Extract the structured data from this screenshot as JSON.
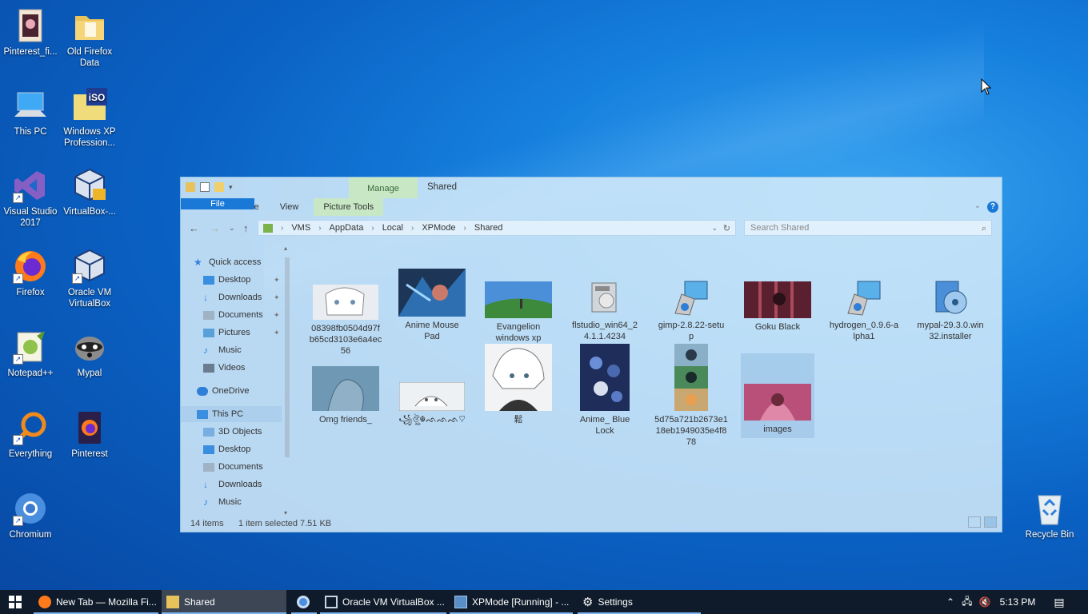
{
  "desktop": {
    "icons": [
      {
        "label": "Pinterest_fi...",
        "icon": "image-file-icon"
      },
      {
        "label": "Old Firefox Data",
        "icon": "folder-icon"
      },
      {
        "label": "This PC",
        "icon": "computer-icon"
      },
      {
        "label": "Windows XP Profession...",
        "icon": "iso-file-icon"
      },
      {
        "label": "Visual Studio 2017",
        "icon": "visual-studio-icon"
      },
      {
        "label": "VirtualBox-...",
        "icon": "virtualbox-installer-icon"
      },
      {
        "label": "Firefox",
        "icon": "firefox-icon"
      },
      {
        "label": "Oracle VM VirtualBox",
        "icon": "virtualbox-icon"
      },
      {
        "label": "Notepad++",
        "icon": "notepadpp-icon"
      },
      {
        "label": "Mypal",
        "icon": "mypal-icon"
      },
      {
        "label": "Everything",
        "icon": "everything-icon"
      },
      {
        "label": "Pinterest",
        "icon": "pinterest-app-icon"
      },
      {
        "label": "Chromium",
        "icon": "chromium-icon"
      },
      {
        "label": "Recycle Bin",
        "icon": "recycle-bin-icon"
      }
    ]
  },
  "explorer": {
    "title": "Shared",
    "contextual_tab_group": "Manage",
    "tabs": [
      "File",
      "Home",
      "Share",
      "View",
      "Picture Tools"
    ],
    "breadcrumb": [
      "VMS",
      "AppData",
      "Local",
      "XPMode",
      "Shared"
    ],
    "search_placeholder": "Search Shared",
    "nav": {
      "quick_access": "Quick access",
      "quick_items": [
        "Desktop",
        "Downloads",
        "Documents",
        "Pictures",
        "Music",
        "Videos"
      ],
      "onedrive": "OneDrive",
      "this_pc": "This PC",
      "pc_items": [
        "3D Objects",
        "Desktop",
        "Documents",
        "Downloads",
        "Music"
      ]
    },
    "files": [
      {
        "name": "08398fb0504d97fb65cd3103e6a4ec56",
        "lines": [
          "08398fb0504d97f",
          "b65cd3103e6a4ec",
          "56"
        ],
        "kind": "manga-image"
      },
      {
        "name": "Anime Mouse Pad",
        "lines": [
          "Anime Mouse",
          "Pad"
        ],
        "kind": "anime-image"
      },
      {
        "name": "Evangelion windows xp version",
        "lines": [
          "Evangelion",
          "windows xp",
          "version"
        ],
        "kind": "landscape-image"
      },
      {
        "name": "flstudio_win64_24.1.1.4234",
        "lines": [
          "flstudio_win64_2",
          "4.1.1.4234"
        ],
        "kind": "installer"
      },
      {
        "name": "gimp-2.8.22-setup",
        "lines": [
          "gimp-2.8.22-setu",
          "p"
        ],
        "kind": "setup"
      },
      {
        "name": "Goku Black",
        "lines": [
          "Goku Black"
        ],
        "kind": "dark-image"
      },
      {
        "name": "hydrogen_0.9.6-alpha1",
        "lines": [
          "hydrogen_0.9.6-a",
          "lpha1"
        ],
        "kind": "setup"
      },
      {
        "name": "mypal-29.3.0.win32.installer",
        "lines": [
          "mypal-29.3.0.win",
          "32.installer"
        ],
        "kind": "disc-installer"
      },
      {
        "name": "Omg friends_",
        "lines": [
          "Omg friends_"
        ],
        "kind": "sketch-image"
      },
      {
        "name": "꧁ঔৣ☬✞𝓚𝓲𝓵𝓵𝓾𝓪✞☬ঔৣ꧂",
        "lines": [
          "꧁ঔৣ☬ᨒᨒᨒ♡"
        ],
        "kind": "manga-image"
      },
      {
        "name": "鬆",
        "lines": [
          "鬆"
        ],
        "kind": "portrait-image"
      },
      {
        "name": "Anime_ Blue Lock",
        "lines": [
          "Anime_ Blue",
          "Lock"
        ],
        "kind": "poster-image"
      },
      {
        "name": "5d75a721b2673e118eb1949035e4f878",
        "lines": [
          "5d75a721b2673e1",
          "18eb1949035e4f8",
          "78"
        ],
        "kind": "strip-image"
      },
      {
        "name": "images",
        "lines": [
          "images"
        ],
        "kind": "pink-image"
      }
    ],
    "status": {
      "count": "14 items",
      "selection": "1 item selected",
      "size": "7.51 KB"
    }
  },
  "taskbar": {
    "items": [
      {
        "label": "New Tab — Mozilla Fi...",
        "icon": "firefox-icon"
      },
      {
        "label": "Shared",
        "icon": "folder-icon"
      },
      {
        "label": "",
        "icon": "chromium-icon"
      },
      {
        "label": "Oracle VM VirtualBox ...",
        "icon": "virtualbox-icon"
      },
      {
        "label": "XPMode [Running] - ...",
        "icon": "xpmode-icon"
      },
      {
        "label": "Settings",
        "icon": "gear-icon"
      }
    ],
    "time": "5:13 PM"
  },
  "colors": {
    "accent": "#1a78d6",
    "taskbar": "#0f1b2a",
    "picture_tools": "#c7e7c5"
  }
}
